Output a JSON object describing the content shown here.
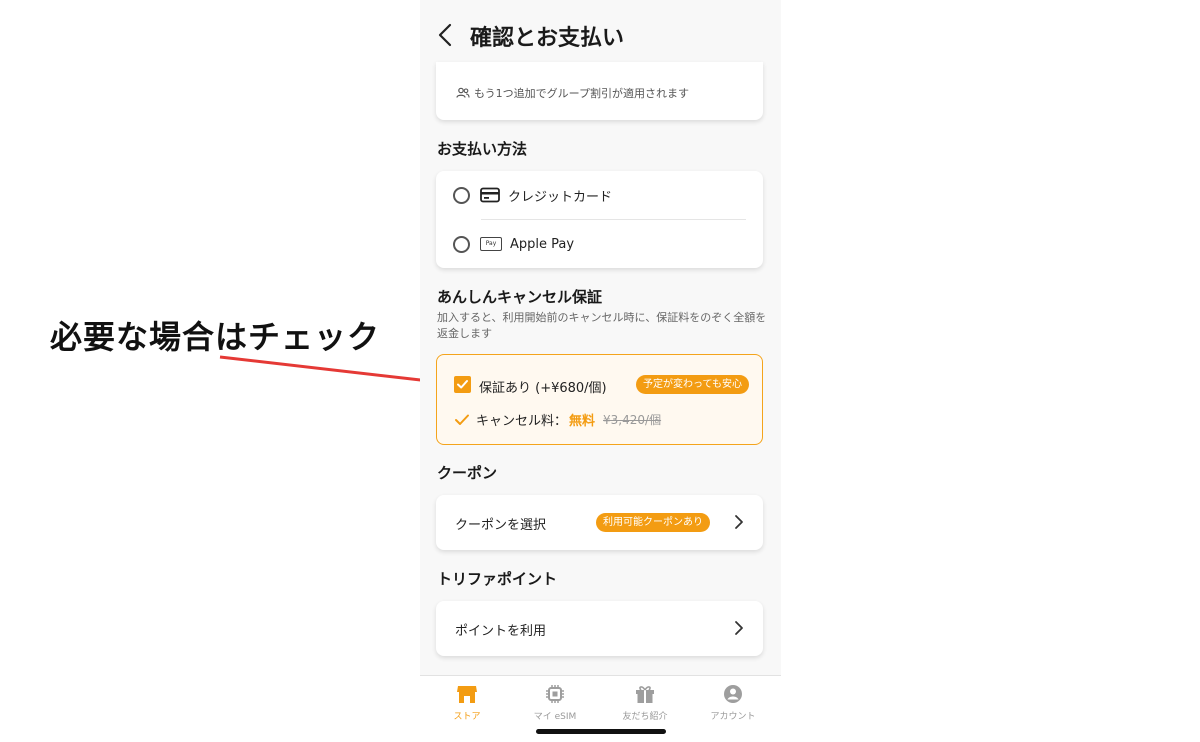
{
  "annotation": {
    "text": "必要な場合はチェック",
    "arrow_color": "#e53935"
  },
  "header": {
    "title": "確認とお支払い"
  },
  "group_discount": {
    "note": "もう1つ追加でグループ割引が適用されます"
  },
  "payment": {
    "section_title": "お支払い方法",
    "options": [
      {
        "label": "クレジットカード",
        "icon": "credit-card-icon",
        "selected": false
      },
      {
        "label": "Apple Pay",
        "icon": "apple-pay-icon",
        "icon_text": "Pay",
        "selected": false
      }
    ]
  },
  "guarantee": {
    "section_title": "あんしんキャンセル保証",
    "description": "加入すると、利用開始前のキャンセル時に、保証料をのぞく全額を返金します",
    "checkbox_label": "保証あり (+¥680/個)",
    "checked": true,
    "badge": "予定が変わっても安心",
    "cancel_fee_label": "キャンセル料：",
    "cancel_fee_value": "無料",
    "cancel_fee_old": "¥3,420/個"
  },
  "coupon": {
    "section_title": "クーポン",
    "row_label": "クーポンを選択",
    "badge": "利用可能クーポンあり"
  },
  "points": {
    "section_title": "トリファポイント",
    "row_label": "ポイントを利用"
  },
  "tabbar": {
    "tabs": [
      {
        "label": "ストア",
        "icon": "store-icon",
        "active": true
      },
      {
        "label": "マイ eSIM",
        "icon": "chip-icon",
        "active": false
      },
      {
        "label": "友だち紹介",
        "icon": "gift-icon",
        "active": false
      },
      {
        "label": "アカウント",
        "icon": "account-icon",
        "active": false
      }
    ]
  },
  "colors": {
    "accent": "#f39c12",
    "background": "#f8f8f8",
    "guarantee_bg": "#fff9f0"
  }
}
